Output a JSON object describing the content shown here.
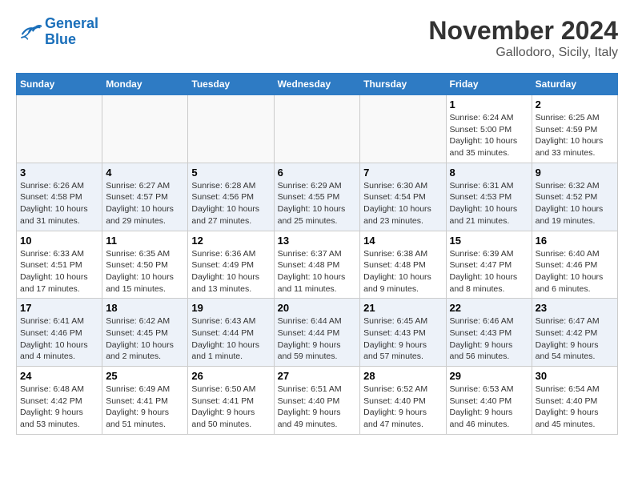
{
  "logo": {
    "line1": "General",
    "line2": "Blue"
  },
  "title": "November 2024",
  "subtitle": "Gallodoro, Sicily, Italy",
  "columns": [
    "Sunday",
    "Monday",
    "Tuesday",
    "Wednesday",
    "Thursday",
    "Friday",
    "Saturday"
  ],
  "weeks": [
    [
      {
        "day": "",
        "info": ""
      },
      {
        "day": "",
        "info": ""
      },
      {
        "day": "",
        "info": ""
      },
      {
        "day": "",
        "info": ""
      },
      {
        "day": "",
        "info": ""
      },
      {
        "day": "1",
        "info": "Sunrise: 6:24 AM\nSunset: 5:00 PM\nDaylight: 10 hours\nand 35 minutes."
      },
      {
        "day": "2",
        "info": "Sunrise: 6:25 AM\nSunset: 4:59 PM\nDaylight: 10 hours\nand 33 minutes."
      }
    ],
    [
      {
        "day": "3",
        "info": "Sunrise: 6:26 AM\nSunset: 4:58 PM\nDaylight: 10 hours\nand 31 minutes."
      },
      {
        "day": "4",
        "info": "Sunrise: 6:27 AM\nSunset: 4:57 PM\nDaylight: 10 hours\nand 29 minutes."
      },
      {
        "day": "5",
        "info": "Sunrise: 6:28 AM\nSunset: 4:56 PM\nDaylight: 10 hours\nand 27 minutes."
      },
      {
        "day": "6",
        "info": "Sunrise: 6:29 AM\nSunset: 4:55 PM\nDaylight: 10 hours\nand 25 minutes."
      },
      {
        "day": "7",
        "info": "Sunrise: 6:30 AM\nSunset: 4:54 PM\nDaylight: 10 hours\nand 23 minutes."
      },
      {
        "day": "8",
        "info": "Sunrise: 6:31 AM\nSunset: 4:53 PM\nDaylight: 10 hours\nand 21 minutes."
      },
      {
        "day": "9",
        "info": "Sunrise: 6:32 AM\nSunset: 4:52 PM\nDaylight: 10 hours\nand 19 minutes."
      }
    ],
    [
      {
        "day": "10",
        "info": "Sunrise: 6:33 AM\nSunset: 4:51 PM\nDaylight: 10 hours\nand 17 minutes."
      },
      {
        "day": "11",
        "info": "Sunrise: 6:35 AM\nSunset: 4:50 PM\nDaylight: 10 hours\nand 15 minutes."
      },
      {
        "day": "12",
        "info": "Sunrise: 6:36 AM\nSunset: 4:49 PM\nDaylight: 10 hours\nand 13 minutes."
      },
      {
        "day": "13",
        "info": "Sunrise: 6:37 AM\nSunset: 4:48 PM\nDaylight: 10 hours\nand 11 minutes."
      },
      {
        "day": "14",
        "info": "Sunrise: 6:38 AM\nSunset: 4:48 PM\nDaylight: 10 hours\nand 9 minutes."
      },
      {
        "day": "15",
        "info": "Sunrise: 6:39 AM\nSunset: 4:47 PM\nDaylight: 10 hours\nand 8 minutes."
      },
      {
        "day": "16",
        "info": "Sunrise: 6:40 AM\nSunset: 4:46 PM\nDaylight: 10 hours\nand 6 minutes."
      }
    ],
    [
      {
        "day": "17",
        "info": "Sunrise: 6:41 AM\nSunset: 4:46 PM\nDaylight: 10 hours\nand 4 minutes."
      },
      {
        "day": "18",
        "info": "Sunrise: 6:42 AM\nSunset: 4:45 PM\nDaylight: 10 hours\nand 2 minutes."
      },
      {
        "day": "19",
        "info": "Sunrise: 6:43 AM\nSunset: 4:44 PM\nDaylight: 10 hours\nand 1 minute."
      },
      {
        "day": "20",
        "info": "Sunrise: 6:44 AM\nSunset: 4:44 PM\nDaylight: 9 hours\nand 59 minutes."
      },
      {
        "day": "21",
        "info": "Sunrise: 6:45 AM\nSunset: 4:43 PM\nDaylight: 9 hours\nand 57 minutes."
      },
      {
        "day": "22",
        "info": "Sunrise: 6:46 AM\nSunset: 4:43 PM\nDaylight: 9 hours\nand 56 minutes."
      },
      {
        "day": "23",
        "info": "Sunrise: 6:47 AM\nSunset: 4:42 PM\nDaylight: 9 hours\nand 54 minutes."
      }
    ],
    [
      {
        "day": "24",
        "info": "Sunrise: 6:48 AM\nSunset: 4:42 PM\nDaylight: 9 hours\nand 53 minutes."
      },
      {
        "day": "25",
        "info": "Sunrise: 6:49 AM\nSunset: 4:41 PM\nDaylight: 9 hours\nand 51 minutes."
      },
      {
        "day": "26",
        "info": "Sunrise: 6:50 AM\nSunset: 4:41 PM\nDaylight: 9 hours\nand 50 minutes."
      },
      {
        "day": "27",
        "info": "Sunrise: 6:51 AM\nSunset: 4:40 PM\nDaylight: 9 hours\nand 49 minutes."
      },
      {
        "day": "28",
        "info": "Sunrise: 6:52 AM\nSunset: 4:40 PM\nDaylight: 9 hours\nand 47 minutes."
      },
      {
        "day": "29",
        "info": "Sunrise: 6:53 AM\nSunset: 4:40 PM\nDaylight: 9 hours\nand 46 minutes."
      },
      {
        "day": "30",
        "info": "Sunrise: 6:54 AM\nSunset: 4:40 PM\nDaylight: 9 hours\nand 45 minutes."
      }
    ]
  ]
}
